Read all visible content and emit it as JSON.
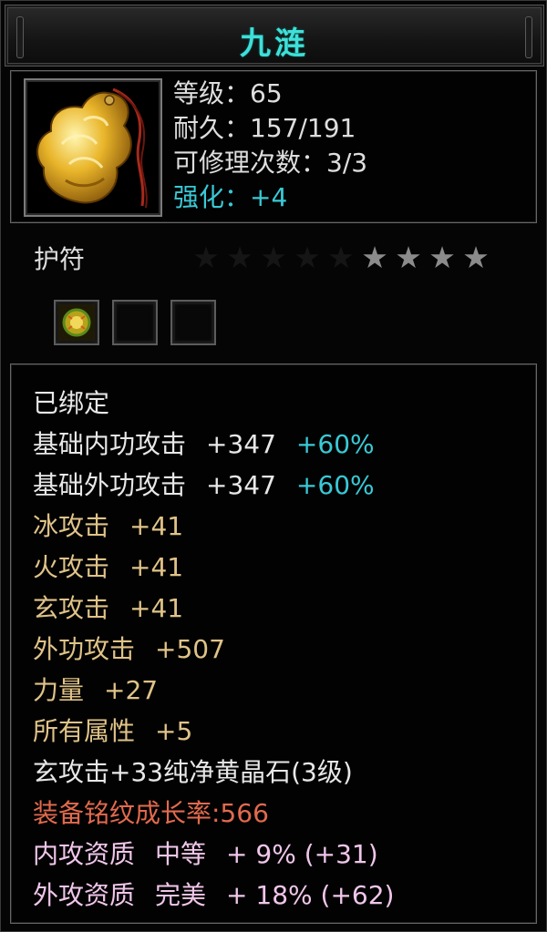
{
  "item": {
    "name": "九涟",
    "stats": {
      "level": "等级：65",
      "durability": "耐久：157/191",
      "repairs": "可修理次数：3/3",
      "enhance": "强化：+4"
    },
    "category": "护符",
    "stars_total": 9,
    "stars_lit": 4,
    "socket_slots": [
      {
        "state": "filled",
        "icon": "gem-icon"
      },
      {
        "state": "empty"
      },
      {
        "state": "empty"
      }
    ]
  },
  "attributes": {
    "bound": "已绑定",
    "base_inner_attack": {
      "label": "基础内功攻击",
      "value": "+347",
      "bonus": "+60%"
    },
    "base_outer_attack": {
      "label": "基础外功攻击",
      "value": "+347",
      "bonus": "+60%"
    },
    "ice_attack": {
      "label": "冰攻击",
      "value": "+41"
    },
    "fire_attack": {
      "label": "火攻击",
      "value": "+41"
    },
    "mystic_attack": {
      "label": "玄攻击",
      "value": "+41"
    },
    "outer_attack": {
      "label": "外功攻击",
      "value": "+507"
    },
    "strength": {
      "label": "力量",
      "value": "+27"
    },
    "all_attributes": {
      "label": "所有属性",
      "value": "+5"
    },
    "gem_line": "玄攻击+33纯净黄晶石(3级)",
    "growth_rate": "装备铭纹成长率:566",
    "inner_quality": {
      "label": "内攻资质",
      "grade": "中等",
      "value": "+ 9% (+31)"
    },
    "outer_quality": {
      "label": "外攻资质",
      "grade": "完美",
      "value": "+ 18% (+62)"
    }
  },
  "colors": {
    "title": "#3ee0d8",
    "gold": "#e0c388",
    "cyan": "#39c9d6",
    "orange": "#e26a4e",
    "pink": "#f0c6ea"
  }
}
